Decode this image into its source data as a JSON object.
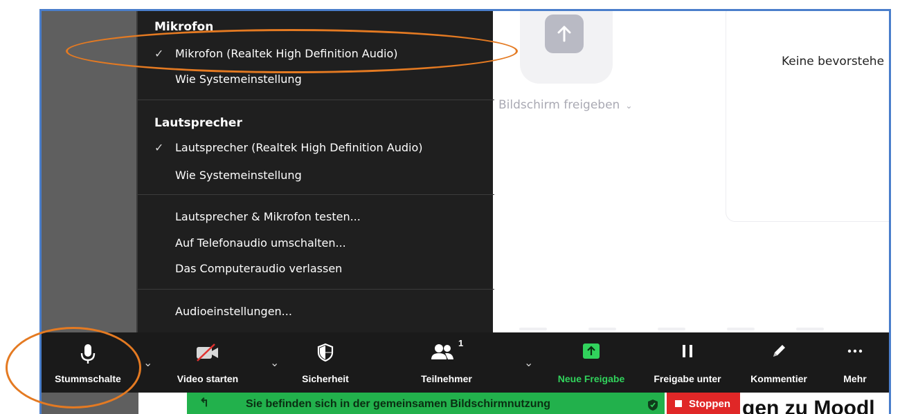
{
  "audio_menu": {
    "mic_heading": "Mikrofon",
    "mic_selected": "Mikrofon (Realtek High Definition Audio)",
    "mic_system": "Wie Systemeinstellung",
    "speaker_heading": "Lautsprecher",
    "speaker_selected": "Lautsprecher (Realtek High Definition Audio)",
    "speaker_system": "Wie Systemeinstellung",
    "test": "Lautsprecher & Mikrofon testen...",
    "phone": "Auf Telefonaudio umschalten...",
    "leave": "Das Computeraudio verlassen",
    "settings": "Audioeinstellungen...",
    "check_glyph": "✓"
  },
  "background": {
    "share_label": "Bildschirm freigeben",
    "upcoming": "Keine bevorstehe"
  },
  "toolbar": {
    "mute": "Stummschalte",
    "video": "Video starten",
    "security": "Sicherheit",
    "participants": "Teilnehmer",
    "participant_count": "1",
    "new_share": "Neue Freigabe",
    "pause_share": "Freigabe unter",
    "annotate": "Kommentier",
    "more": "Mehr"
  },
  "share_bar": {
    "message": "Sie befinden sich in der gemeinsamen Bildschirmnutzung",
    "stop": "Stoppen"
  },
  "under_text": "gen zu Moodl",
  "colors": {
    "accent_green": "#31d35c",
    "share_bar": "#22b14c",
    "stop_red": "#e02727",
    "highlight_orange": "#e47a22"
  }
}
